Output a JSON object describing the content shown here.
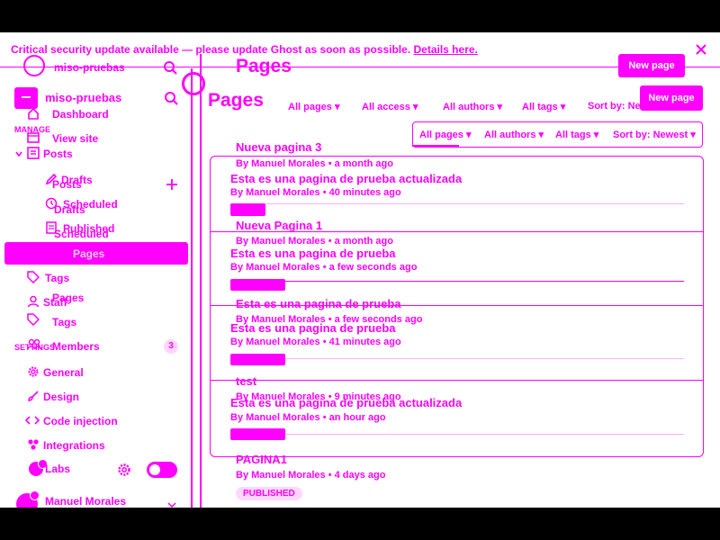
{
  "alert": {
    "text": "Critical security update available — please update Ghost as soon as possible.",
    "link": "Details here."
  },
  "site": {
    "name": "miso-pruebas"
  },
  "nav": {
    "dashboard": "Dashboard",
    "view_site": "View site",
    "manage": "MANAGE",
    "posts": "Posts",
    "drafts": "Drafts",
    "scheduled": "Scheduled",
    "published": "Published",
    "pages": "Pages",
    "tags": "Tags",
    "staff": "Staff",
    "members": "Members",
    "members_count": "3",
    "settings": "SETTINGS",
    "general": "General",
    "design": "Design",
    "code_injection": "Code injection",
    "integrations": "Integrations",
    "labs": "Labs",
    "user_name": "Manuel Morales"
  },
  "ghost_sidebar": {
    "posts": "Posts",
    "drafts": "Drafts",
    "scheduled": "Scheduled",
    "pages": "Pages",
    "tags": "Tags"
  },
  "main": {
    "title": "Pages",
    "new_page": "New page"
  },
  "filters": {
    "row1": [
      "All pages",
      "All access",
      "All authors",
      "All tags",
      "Sort by: Ne"
    ],
    "row2": [
      "All pages",
      "All authors",
      "All tags",
      "Sort by: Newest"
    ]
  },
  "list": [
    {
      "title": "Nueva pagina 3",
      "meta": "By Manuel Morales • a month ago"
    },
    {
      "title": "Esta es una pagina de prueba actualizada",
      "meta": "By Manuel Morales • 40 minutes ago"
    },
    {
      "title": "Nueva Pagina 1",
      "meta": "By Manuel Morales • a month ago"
    },
    {
      "title": "Esta es una pagina de prueba",
      "meta": "By Manuel Morales • a few seconds ago"
    },
    {
      "title": "Esta es una pagina de prueba",
      "meta": "By Manuel Morales • a few seconds ago"
    },
    {
      "title": "Esta es una pagina de prueba",
      "meta": "By Manuel Morales • 41 minutes ago"
    },
    {
      "title": "test",
      "meta": "By Manuel Morales • 9 minutes ago"
    },
    {
      "title": "Esta es una pagina de prueba actualizada",
      "meta": "By Manuel Morales • an hour ago"
    },
    {
      "title": "PAGINA1",
      "meta": "By Manuel Morales • 4 days ago",
      "status": "PUBLISHED"
    }
  ],
  "colors": {
    "accent": "#ff00ff",
    "background": "#ffffff",
    "letterbox": "#000000"
  }
}
